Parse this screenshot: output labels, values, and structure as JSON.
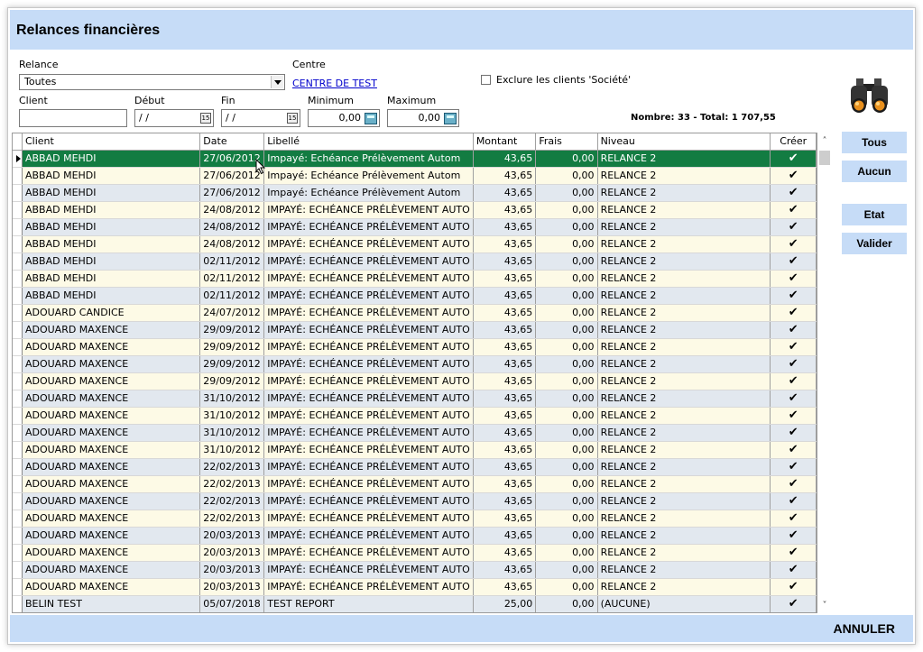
{
  "window": {
    "title": "Relances financières"
  },
  "filters": {
    "relance_label": "Relance",
    "relance_value": "Toutes",
    "centre_label": "Centre",
    "centre_value": "CENTRE DE TEST",
    "exclude_label": "Exclure les clients 'Société'",
    "client_label": "Client",
    "client_value": "",
    "debut_label": "Début",
    "debut_value": "/ /",
    "fin_label": "Fin",
    "fin_value": "/ /",
    "minimum_label": "Minimum",
    "minimum_value": "0,00",
    "maximum_label": "Maximum",
    "maximum_value": "0,00",
    "calendar_glyph": "15"
  },
  "summary": "Nombre: 33 - Total: 1 707,55",
  "grid": {
    "columns": [
      "Client",
      "Date",
      "Libellé",
      "Montant",
      "Frais",
      "Niveau",
      "Créer"
    ],
    "check_glyph": "✔",
    "rows": [
      {
        "client": "ABBAD MEHDI",
        "date": "27/06/2012",
        "libelle": "Impayé: Echéance Prélèvement Autom",
        "montant": "43,65",
        "frais": "0,00",
        "niveau": "RELANCE 2"
      },
      {
        "client": "ABBAD MEHDI",
        "date": "27/06/2012",
        "libelle": "Impayé: Echéance Prélèvement Autom",
        "montant": "43,65",
        "frais": "0,00",
        "niveau": "RELANCE 2"
      },
      {
        "client": "ABBAD MEHDI",
        "date": "27/06/2012",
        "libelle": "Impayé: Echéance Prélèvement Autom",
        "montant": "43,65",
        "frais": "0,00",
        "niveau": "RELANCE 2"
      },
      {
        "client": "ABBAD MEHDI",
        "date": "24/08/2012",
        "libelle": "IMPAYÉ: ECHÉANCE PRÉLÈVEMENT AUTO",
        "montant": "43,65",
        "frais": "0,00",
        "niveau": "RELANCE 2"
      },
      {
        "client": "ABBAD MEHDI",
        "date": "24/08/2012",
        "libelle": "IMPAYÉ: ECHÉANCE PRÉLÈVEMENT AUTO",
        "montant": "43,65",
        "frais": "0,00",
        "niveau": "RELANCE 2"
      },
      {
        "client": "ABBAD MEHDI",
        "date": "24/08/2012",
        "libelle": "IMPAYÉ: ECHÉANCE PRÉLÈVEMENT AUTO",
        "montant": "43,65",
        "frais": "0,00",
        "niveau": "RELANCE 2"
      },
      {
        "client": "ABBAD MEHDI",
        "date": "02/11/2012",
        "libelle": "IMPAYÉ: ECHÉANCE PRÉLÈVEMENT AUTO",
        "montant": "43,65",
        "frais": "0,00",
        "niveau": "RELANCE 2"
      },
      {
        "client": "ABBAD MEHDI",
        "date": "02/11/2012",
        "libelle": "IMPAYÉ: ECHÉANCE PRÉLÈVEMENT AUTO",
        "montant": "43,65",
        "frais": "0,00",
        "niveau": "RELANCE 2"
      },
      {
        "client": "ABBAD MEHDI",
        "date": "02/11/2012",
        "libelle": "IMPAYÉ: ECHÉANCE PRÉLÈVEMENT AUTO",
        "montant": "43,65",
        "frais": "0,00",
        "niveau": "RELANCE 2"
      },
      {
        "client": "ADOUARD CANDICE",
        "date": "24/07/2012",
        "libelle": "IMPAYÉ: ECHÉANCE PRÉLÈVEMENT AUTO",
        "montant": "43,65",
        "frais": "0,00",
        "niveau": "RELANCE 2"
      },
      {
        "client": "ADOUARD MAXENCE",
        "date": "29/09/2012",
        "libelle": "IMPAYÉ: ECHÉANCE PRÉLÈVEMENT AUTO",
        "montant": "43,65",
        "frais": "0,00",
        "niveau": "RELANCE 2"
      },
      {
        "client": "ADOUARD MAXENCE",
        "date": "29/09/2012",
        "libelle": "IMPAYÉ: ECHÉANCE PRÉLÈVEMENT AUTO",
        "montant": "43,65",
        "frais": "0,00",
        "niveau": "RELANCE 2"
      },
      {
        "client": "ADOUARD MAXENCE",
        "date": "29/09/2012",
        "libelle": "IMPAYÉ: ECHÉANCE PRÉLÈVEMENT AUTO",
        "montant": "43,65",
        "frais": "0,00",
        "niveau": "RELANCE 2"
      },
      {
        "client": "ADOUARD MAXENCE",
        "date": "29/09/2012",
        "libelle": "IMPAYÉ: ECHÉANCE PRÉLÈVEMENT AUTO",
        "montant": "43,65",
        "frais": "0,00",
        "niveau": "RELANCE 2"
      },
      {
        "client": "ADOUARD MAXENCE",
        "date": "31/10/2012",
        "libelle": "IMPAYÉ: ECHÉANCE PRÉLÈVEMENT AUTO",
        "montant": "43,65",
        "frais": "0,00",
        "niveau": "RELANCE 2"
      },
      {
        "client": "ADOUARD MAXENCE",
        "date": "31/10/2012",
        "libelle": "IMPAYÉ: ECHÉANCE PRÉLÈVEMENT AUTO",
        "montant": "43,65",
        "frais": "0,00",
        "niveau": "RELANCE 2"
      },
      {
        "client": "ADOUARD MAXENCE",
        "date": "31/10/2012",
        "libelle": "IMPAYÉ: ECHÉANCE PRÉLÈVEMENT AUTO",
        "montant": "43,65",
        "frais": "0,00",
        "niveau": "RELANCE 2"
      },
      {
        "client": "ADOUARD MAXENCE",
        "date": "31/10/2012",
        "libelle": "IMPAYÉ: ECHÉANCE PRÉLÈVEMENT AUTO",
        "montant": "43,65",
        "frais": "0,00",
        "niveau": "RELANCE 2"
      },
      {
        "client": "ADOUARD MAXENCE",
        "date": "22/02/2013",
        "libelle": "IMPAYÉ: ECHÉANCE PRÉLÈVEMENT AUTO",
        "montant": "43,65",
        "frais": "0,00",
        "niveau": "RELANCE 2"
      },
      {
        "client": "ADOUARD MAXENCE",
        "date": "22/02/2013",
        "libelle": "IMPAYÉ: ECHÉANCE PRÉLÈVEMENT AUTO",
        "montant": "43,65",
        "frais": "0,00",
        "niveau": "RELANCE 2"
      },
      {
        "client": "ADOUARD MAXENCE",
        "date": "22/02/2013",
        "libelle": "IMPAYÉ: ECHÉANCE PRÉLÈVEMENT AUTO",
        "montant": "43,65",
        "frais": "0,00",
        "niveau": "RELANCE 2"
      },
      {
        "client": "ADOUARD MAXENCE",
        "date": "22/02/2013",
        "libelle": "IMPAYÉ: ECHÉANCE PRÉLÈVEMENT AUTO",
        "montant": "43,65",
        "frais": "0,00",
        "niveau": "RELANCE 2"
      },
      {
        "client": "ADOUARD MAXENCE",
        "date": "20/03/2013",
        "libelle": "IMPAYÉ: ECHÉANCE PRÉLÈVEMENT AUTO",
        "montant": "43,65",
        "frais": "0,00",
        "niveau": "RELANCE 2"
      },
      {
        "client": "ADOUARD MAXENCE",
        "date": "20/03/2013",
        "libelle": "IMPAYÉ: ECHÉANCE PRÉLÈVEMENT AUTO",
        "montant": "43,65",
        "frais": "0,00",
        "niveau": "RELANCE 2"
      },
      {
        "client": "ADOUARD MAXENCE",
        "date": "20/03/2013",
        "libelle": "IMPAYÉ: ECHÉANCE PRÉLÈVEMENT AUTO",
        "montant": "43,65",
        "frais": "0,00",
        "niveau": "RELANCE 2"
      },
      {
        "client": "ADOUARD MAXENCE",
        "date": "20/03/2013",
        "libelle": "IMPAYÉ: ECHÉANCE PRÉLÈVEMENT AUTO",
        "montant": "43,65",
        "frais": "0,00",
        "niveau": "RELANCE 2"
      },
      {
        "client": "BELIN TEST",
        "date": "05/07/2018",
        "libelle": "TEST REPORT",
        "montant": "25,00",
        "frais": "0,00",
        "niveau": "(AUCUNE)"
      }
    ]
  },
  "buttons": {
    "tous": "Tous",
    "aucun": "Aucun",
    "etat": "Etat",
    "valider": "Valider",
    "annuler": "ANNULER"
  },
  "scroll": {
    "up": "˄",
    "down": "˅"
  },
  "colors": {
    "header_band": "#c6dcf7",
    "selected_row": "#137c42",
    "row_alt_a": "#e2e8ef",
    "row_alt_b": "#fdfae6"
  }
}
